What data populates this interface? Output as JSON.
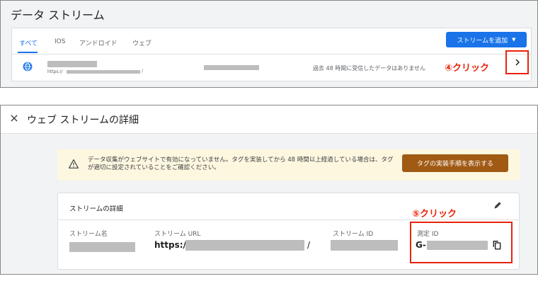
{
  "data_streams": {
    "title": "データ ストリーム",
    "tabs": [
      {
        "label": "すべて",
        "active": true
      },
      {
        "label": "IOS",
        "active": false
      },
      {
        "label": "アンドロイド",
        "active": false
      },
      {
        "label": "ウェブ",
        "active": false
      }
    ],
    "add_button_label": "ストリームを追加",
    "stream_row": {
      "icon": "globe-icon",
      "url_prefix": "https://",
      "url_suffix": "/",
      "status_text": "過去 48 時間に受信したデータはありません",
      "open_icon": "chevron-right-icon"
    },
    "annotation_step4": "④クリック"
  },
  "web_stream_details": {
    "title": "ウェブ ストリームの詳細",
    "close_icon": "close-icon",
    "warning": {
      "icon": "warning-icon",
      "text": "データ収集がウェブサイトで有効になっていません。タグを実装してから 48 時間以上経過している場合は、タグが適切に設定されていることをご確認ください。",
      "button_label": "タグの実装手順を表示する"
    },
    "stream_details": {
      "title": "ストリームの詳細",
      "edit_icon": "pencil-icon",
      "annotation_step5": "⑤クリック",
      "fields": {
        "stream_name_label": "ストリーム名",
        "stream_url_label": "ストリーム URL",
        "stream_url_prefix": "https://",
        "stream_url_suffix": "/",
        "stream_id_label": "ストリーム ID",
        "measurement_id_label": "測定 ID",
        "measurement_id_prefix": "G-"
      },
      "copy_icon": "copy-icon"
    }
  },
  "colors": {
    "accent_blue": "#1a73e8",
    "annotation_red": "#e8230a",
    "warning_button": "#a05a14",
    "warning_background": "#fef7e0",
    "redaction_gray": "#bdbdbd"
  }
}
